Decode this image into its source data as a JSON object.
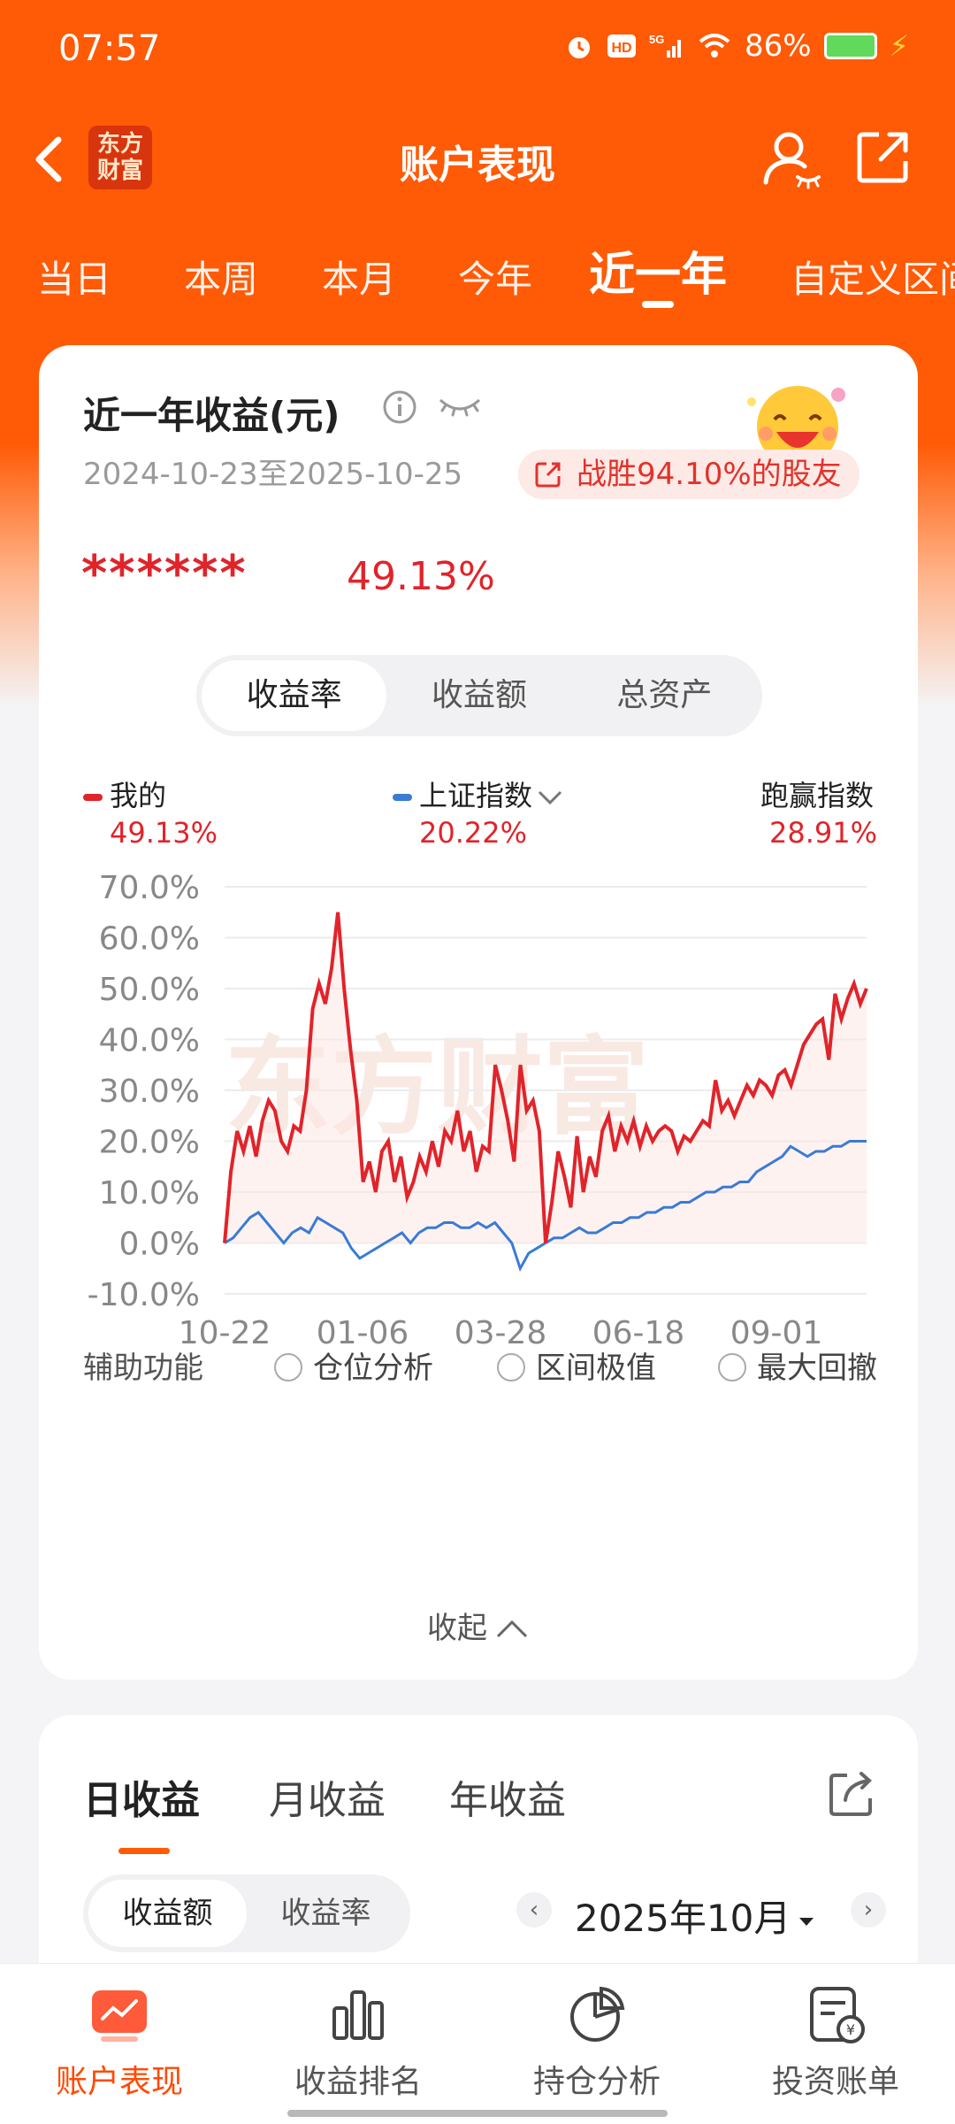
{
  "status_bar": {
    "time": "07:57",
    "battery": "86%"
  },
  "header": {
    "title": "账户表现",
    "logo_text": "东方财富"
  },
  "period_tabs": [
    "当日",
    "本周",
    "本月",
    "今年",
    "近一年",
    "自定义区间"
  ],
  "summary": {
    "title": "近一年收益(元)",
    "date_range": "2024-10-23至2025-10-25",
    "beat_badge": "战胜94.10%的股友",
    "hidden_amount": "******",
    "return_pct": "49.13%"
  },
  "metric_tabs": [
    "收益率",
    "收益额",
    "总资产"
  ],
  "legend": {
    "mine_label": "我的",
    "mine_value": "49.13%",
    "index_label": "上证指数",
    "index_value": "20.22%",
    "beat_label": "跑赢指数",
    "beat_value": "28.91%"
  },
  "colors": {
    "brand": "#ff5a05",
    "mine": "#e0242a",
    "index": "#3a7bd5"
  },
  "watermark": "东方财富",
  "chart_data": {
    "type": "line",
    "y_ticks": [
      "70.0%",
      "60.0%",
      "50.0%",
      "40.0%",
      "30.0%",
      "20.0%",
      "10.0%",
      "0.0%",
      "-10.0%"
    ],
    "x_ticks": [
      "10-22",
      "01-06",
      "03-28",
      "06-18",
      "09-01"
    ],
    "ylim": [
      -10,
      70
    ],
    "grid": true,
    "series": [
      {
        "name": "我的",
        "values": [
          0,
          14,
          22,
          18,
          23,
          17,
          24,
          28,
          26,
          20,
          18,
          23,
          22,
          30,
          46,
          51,
          47,
          54,
          65,
          50,
          38,
          28,
          12,
          16,
          10,
          18,
          20,
          12,
          17,
          9,
          12,
          17,
          14,
          20,
          15,
          22,
          20,
          26,
          18,
          22,
          14,
          19,
          18,
          35,
          30,
          24,
          16,
          35,
          26,
          28,
          22,
          0,
          8,
          18,
          13,
          7,
          21,
          10,
          17,
          13,
          22,
          25,
          18,
          23,
          20,
          24,
          19,
          23,
          20,
          22,
          23,
          22,
          18,
          21,
          20,
          22,
          24,
          23,
          32,
          26,
          28,
          25,
          28,
          31,
          29,
          32,
          31,
          29,
          33,
          34,
          31,
          35,
          39,
          41,
          43,
          44,
          36,
          49,
          44,
          48,
          51,
          47,
          50
        ]
      },
      {
        "name": "上证指数",
        "values": [
          0,
          1,
          3,
          5,
          6,
          4,
          2,
          0,
          2,
          3,
          2,
          5,
          4,
          3,
          2,
          -1,
          -3,
          -2,
          -1,
          0,
          1,
          2,
          0,
          2,
          3,
          3,
          4,
          4,
          3,
          3,
          4,
          3,
          4,
          2,
          0,
          -5,
          -2,
          -1,
          0,
          1,
          1,
          2,
          3,
          2,
          2,
          3,
          4,
          4,
          5,
          5,
          6,
          6,
          7,
          7,
          8,
          8,
          9,
          10,
          10,
          11,
          11,
          12,
          12,
          14,
          15,
          16,
          17,
          19,
          18,
          17,
          18,
          18,
          19,
          19,
          20,
          20,
          20
        ]
      }
    ]
  },
  "aux": {
    "label": "辅助功能",
    "options": [
      "仓位分析",
      "区间极值",
      "最大回撤"
    ]
  },
  "collapse_label": "收起",
  "daily": {
    "tabs": [
      "日收益",
      "月收益",
      "年收益"
    ],
    "metric_tabs": [
      "收益额",
      "收益率"
    ],
    "month": "2025年10月"
  },
  "bottom_nav": [
    "账户表现",
    "收益排名",
    "持仓分析",
    "投资账单"
  ]
}
